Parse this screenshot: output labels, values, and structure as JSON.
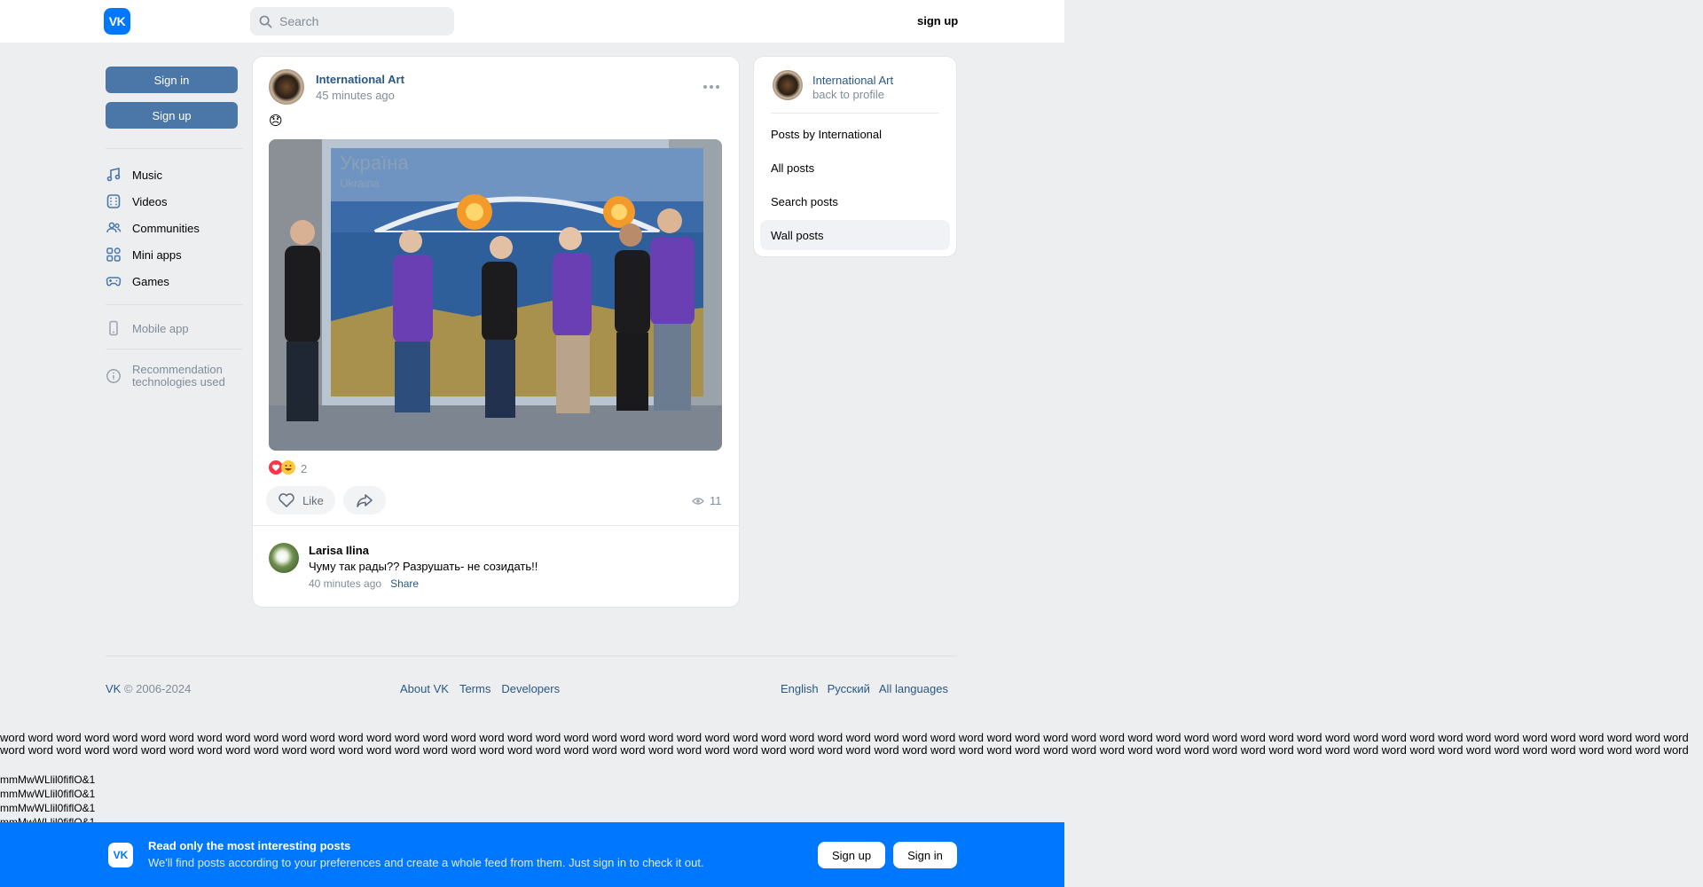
{
  "header": {
    "logo_text": "VK",
    "search_placeholder": "Search",
    "signup_label": "sign up"
  },
  "left_nav": {
    "sign_in": "Sign in",
    "sign_up": "Sign up",
    "items": [
      {
        "label": "Music",
        "icon": "music-icon"
      },
      {
        "label": "Videos",
        "icon": "video-icon"
      },
      {
        "label": "Communities",
        "icon": "communities-icon"
      },
      {
        "label": "Mini apps",
        "icon": "mini-apps-icon"
      },
      {
        "label": "Games",
        "icon": "gamepad-icon"
      }
    ],
    "mobile_app": "Mobile app",
    "recommendation_line1": "Recommendation",
    "recommendation_line2": "technologies used"
  },
  "post": {
    "author": "International Art",
    "time": "45 minutes ago",
    "emoji": "😞",
    "photo_title": "Україна",
    "photo_subtitle": "Ukraina",
    "reactions_count": "2",
    "like_label": "Like",
    "views": "11"
  },
  "comment": {
    "author": "Larisa Ilina",
    "text": "Чуму так рады?? Разрушать- не созидать!!",
    "time": "40 minutes ago",
    "share": "Share"
  },
  "right_panel": {
    "name": "International Art",
    "back": "back to profile",
    "items": [
      {
        "label": "Posts by International",
        "active": false
      },
      {
        "label": "All posts",
        "active": false
      },
      {
        "label": "Search posts",
        "active": false
      },
      {
        "label": "Wall posts",
        "active": true
      }
    ]
  },
  "footer": {
    "brand": "VK",
    "copyright": " © 2006-2024",
    "links": [
      "About VK",
      "Terms",
      "Developers"
    ],
    "languages": [
      "English",
      "Русский",
      "All languages"
    ]
  },
  "filler": {
    "word_line": "word word word word word word word word word word word word word word word word word word word word word word word word word word word word word word word word word word word word word word word word word word word word word word word word word word word word word word word word word word word word",
    "mm_line": "mmMwWLlil0fiflO&1"
  },
  "banner": {
    "logo_text": "VK",
    "title": "Read only the most interesting posts",
    "subtitle": "We'll find posts according to your preferences and create a whole feed from them. Just sign in to check it out.",
    "signup": "Sign up",
    "signin": "Sign in"
  }
}
